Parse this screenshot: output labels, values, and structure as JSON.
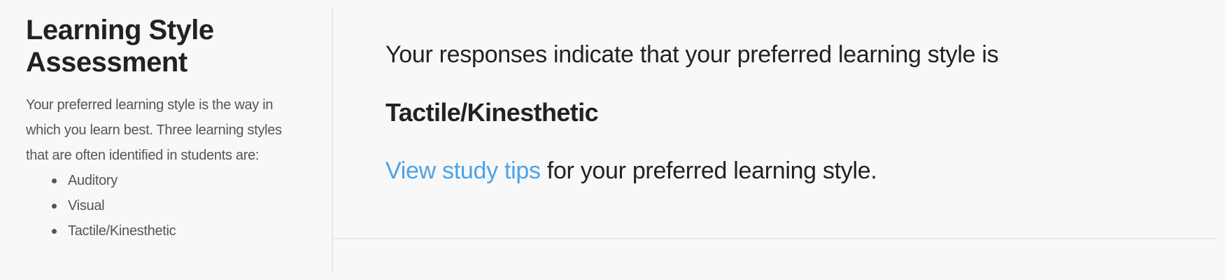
{
  "sidebar": {
    "title_line1": "Learning Style",
    "title_line2": "Assessment",
    "description": "Your preferred learning style is the way in which you learn best. Three learning styles that are often identified in students are:",
    "styles": [
      {
        "label": "Auditory"
      },
      {
        "label": "Visual"
      },
      {
        "label": "Tactile/Kinesthetic"
      }
    ]
  },
  "main": {
    "result_intro": "Your responses indicate that your preferred learning style is",
    "result_style": "Tactile/Kinesthetic",
    "tips_link_label": "View study tips",
    "tips_suffix": " for your preferred learning style."
  },
  "colors": {
    "link": "#4aa3e8",
    "heading": "#222222",
    "body_text": "#555555",
    "background": "#f8f8f8",
    "divider": "#e8e8e8"
  }
}
